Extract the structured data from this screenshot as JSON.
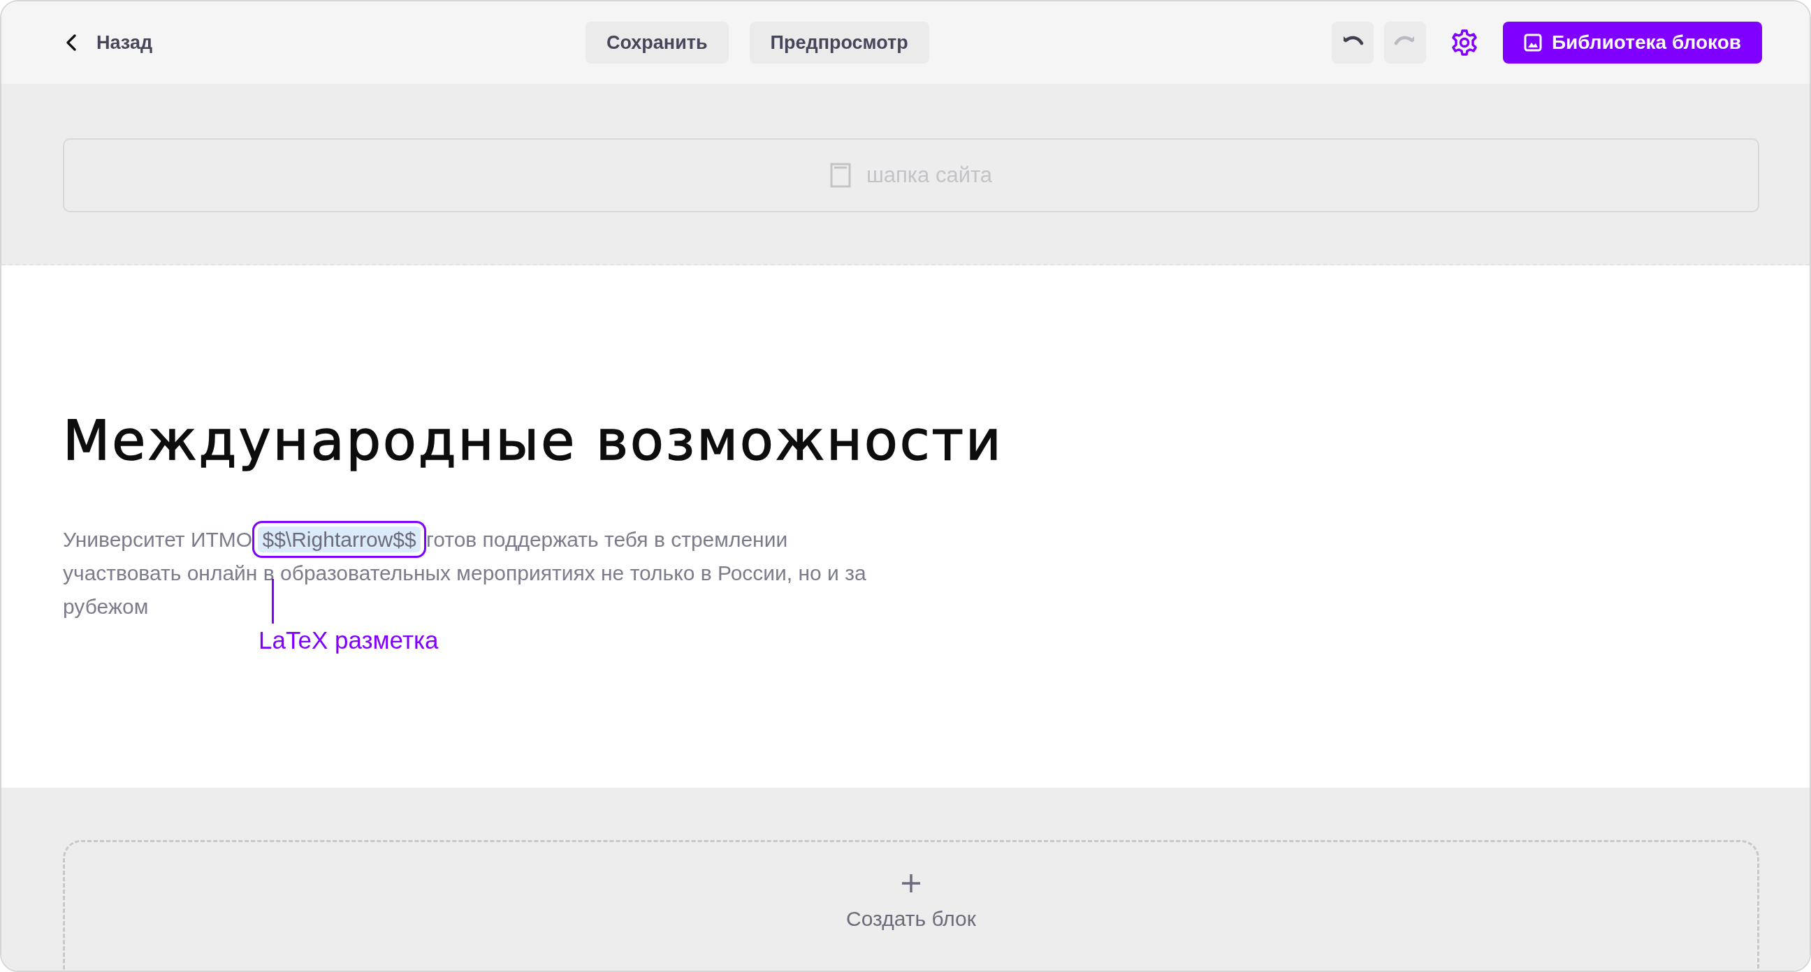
{
  "toolbar": {
    "back": {
      "label": "Назад"
    },
    "buttons": [
      {
        "label": "Сохранить"
      },
      {
        "label": "Предпросмотр"
      }
    ],
    "undo": {
      "disabled": false
    },
    "redo": {
      "disabled": true
    },
    "library_button": {
      "label": "Библиотека блоков"
    }
  },
  "header_placeholder": {
    "label": "шапка сайта"
  },
  "content": {
    "title": "Международные возможности",
    "paragraph": {
      "before": "Университет ИТМО",
      "selection": "$$\\Rightarrow$$",
      "after": "готов поддержать тебя в стремлении участвовать онлайн в образовательных мероприятиях не только в России, но и за рубежом"
    },
    "annotation": {
      "label": "LaTeX разметка"
    }
  },
  "create_block": {
    "label": "Создать блок"
  }
}
